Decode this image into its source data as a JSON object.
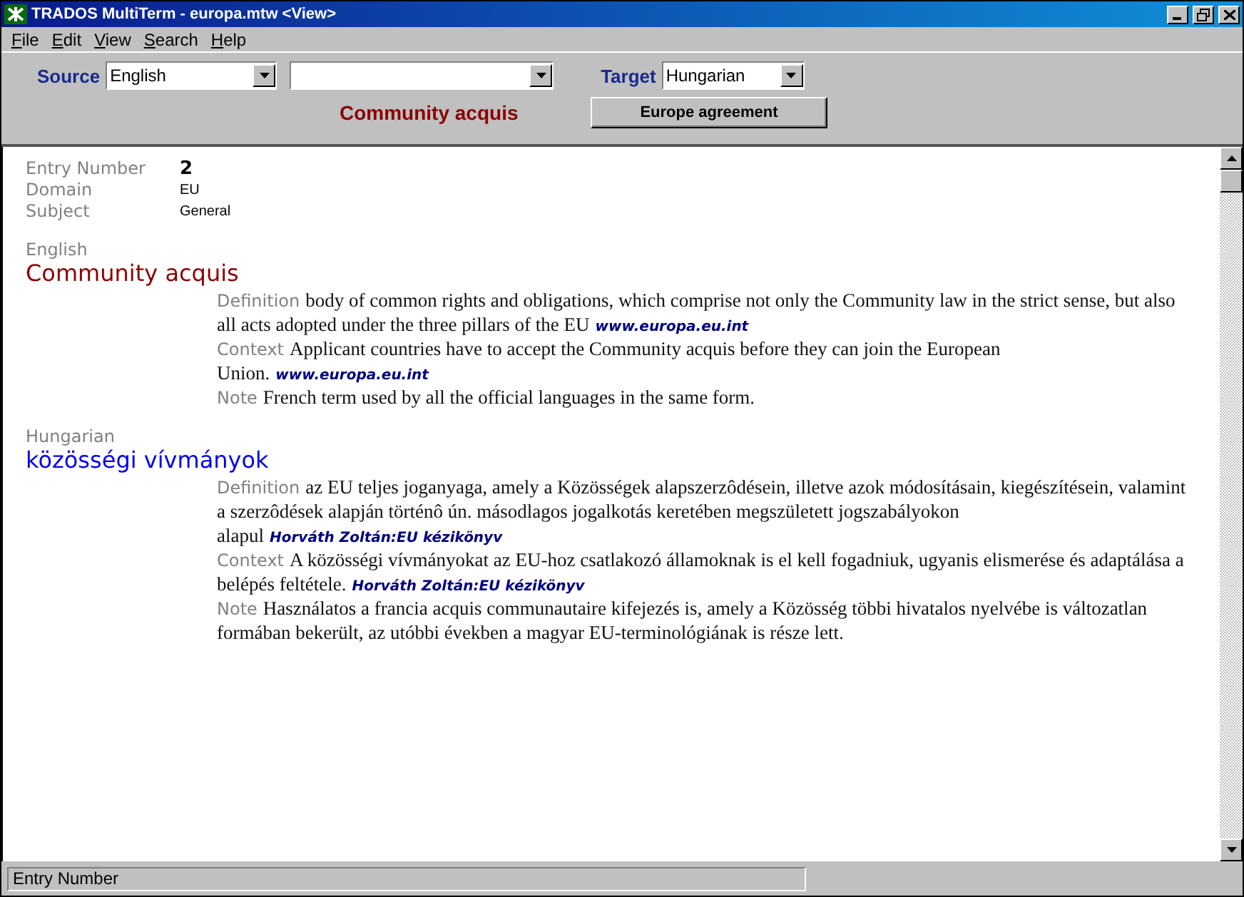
{
  "window": {
    "title": "TRADOS MultiTerm - europa.mtw <View>"
  },
  "menu": [
    "File",
    "Edit",
    "View",
    "Search",
    "Help"
  ],
  "toolbar": {
    "source": {
      "label": "Source",
      "value": "English"
    },
    "target": {
      "label": "Target",
      "value": "Hungarian"
    },
    "current_term": "Community acquis",
    "button": "Europe agreement"
  },
  "entry": {
    "header": [
      {
        "label": "Entry Number",
        "value": "2",
        "kind": "number"
      },
      {
        "label": "Domain",
        "value": "EU",
        "kind": "plain"
      },
      {
        "label": "Subject",
        "value": "General",
        "kind": "plain"
      }
    ],
    "languages": [
      {
        "language": "English",
        "term": "Community acquis",
        "kind": "source",
        "fields": [
          {
            "label": "Definition",
            "text": "body of common rights and obligations, which comprise not only the Community law in the strict sense, but also all acts adopted under the three pillars of the EU",
            "source": "www.europa.eu.int"
          },
          {
            "label": "Context",
            "text": "Applicant countries have to accept the Community acquis before they can join the European Union.",
            "source": "www.europa.eu.int"
          },
          {
            "label": "Note",
            "text": "French term used by all the official languages in the same form."
          }
        ]
      },
      {
        "language": "Hungarian",
        "term": "közösségi vívmányok",
        "kind": "target",
        "fields": [
          {
            "label": "Definition",
            "text": "az EU teljes joganyaga, amely a Közösségek alapszerzôdésein, illetve azok módosításain, kiegészítésein, valamint a szerzôdések alapján történô ún. másodlagos jogalkotás keretében megszületett jogszabályokon alapul",
            "source": "Horváth Zoltán:EU kézikönyv"
          },
          {
            "label": "Context",
            "text": "A közösségi vívmányokat az EU-hoz csatlakozó államoknak is el kell fogadniuk, ugyanis elismerése és adaptálása a belépés feltétele.",
            "source": "Horváth Zoltán:EU kézikönyv"
          },
          {
            "label": "Note",
            "text": "Használatos a francia acquis communautaire kifejezés is, amely a Közösség többi hivatalos nyelvébe is változatlan formában bekerült, az utóbbi években a magyar EU-terminológiának is része lett."
          }
        ]
      }
    ]
  },
  "status_bar": "Entry Number"
}
